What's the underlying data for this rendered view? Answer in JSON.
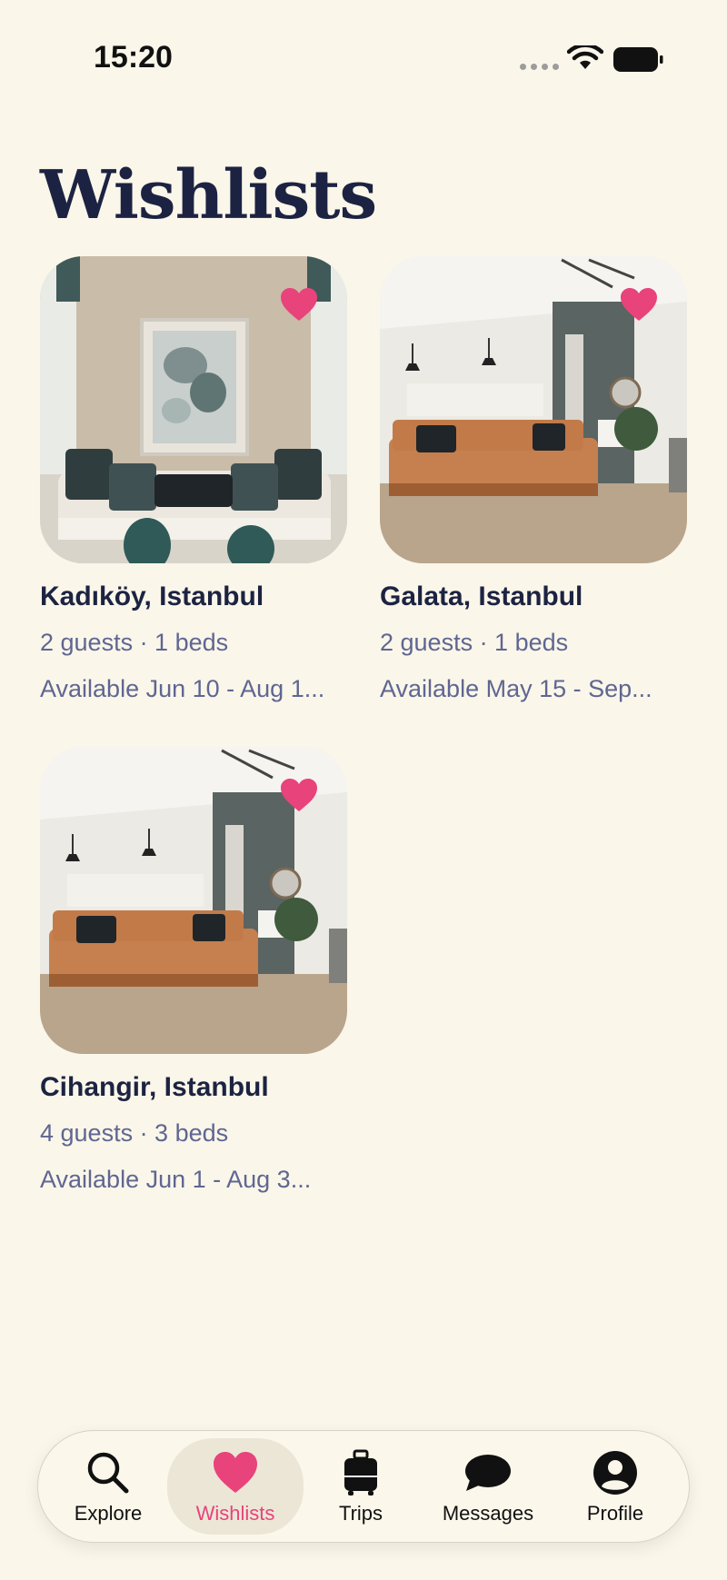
{
  "status_bar": {
    "time": "15:20"
  },
  "title": "Wishlists",
  "colors": {
    "accent": "#e8437b",
    "title": "#1c2342",
    "muted": "#5f6692",
    "background": "#faf6e9"
  },
  "wishlists": [
    {
      "title": "Kadıköy, Istanbul",
      "guests_beds": "2 guests · 1 beds",
      "availability": "Available Jun 10 - Aug 1...",
      "saved": true
    },
    {
      "title": "Galata, Istanbul",
      "guests_beds": "2 guests · 1 beds",
      "availability": "Available May 15 - Sep...",
      "saved": true
    },
    {
      "title": "Cihangir, Istanbul",
      "guests_beds": "4 guests · 3 beds",
      "availability": "Available Jun 1 - Aug 3...",
      "saved": true
    }
  ],
  "tabs": [
    {
      "label": "Explore",
      "icon": "search-icon",
      "active": false
    },
    {
      "label": "Wishlists",
      "icon": "heart-icon",
      "active": true
    },
    {
      "label": "Trips",
      "icon": "suitcase-icon",
      "active": false
    },
    {
      "label": "Messages",
      "icon": "chat-bubble-icon",
      "active": false
    },
    {
      "label": "Profile",
      "icon": "person-icon",
      "active": false
    }
  ]
}
